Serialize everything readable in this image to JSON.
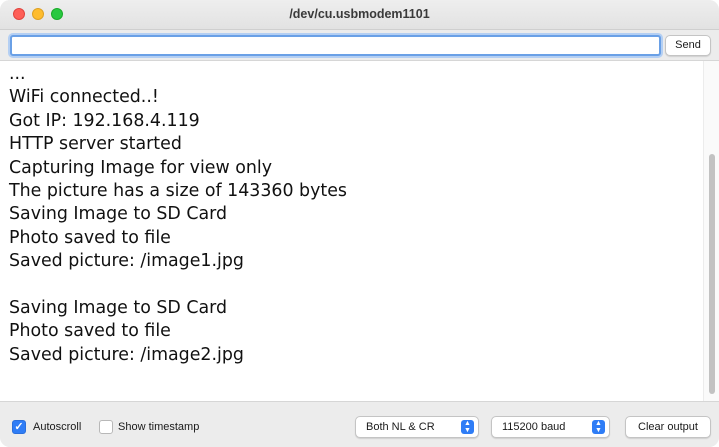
{
  "window": {
    "title": "/dev/cu.usbmodem1101"
  },
  "input_bar": {
    "message_value": "",
    "send_label": "Send"
  },
  "serial_output": {
    "lines": [
      "...",
      "WiFi connected..!",
      "Got IP: 192.168.4.119",
      "HTTP server started",
      "Capturing Image for view only",
      "The picture has a size of 143360 bytes",
      "Saving Image to SD Card",
      "Photo saved to file",
      "Saved picture: /image1.jpg",
      "",
      "Saving Image to SD Card",
      "Photo saved to file",
      "Saved picture: /image2.jpg"
    ]
  },
  "bottom_bar": {
    "autoscroll": {
      "label": "Autoscroll",
      "checked": true
    },
    "show_timestamp": {
      "label": "Show timestamp",
      "checked": false
    },
    "line_ending": {
      "value": "Both NL & CR"
    },
    "baud_rate": {
      "value": "115200 baud"
    },
    "clear_label": "Clear output"
  },
  "colors": {
    "accent": "#2f7df6",
    "focus_ring": "#6aa0e6"
  }
}
